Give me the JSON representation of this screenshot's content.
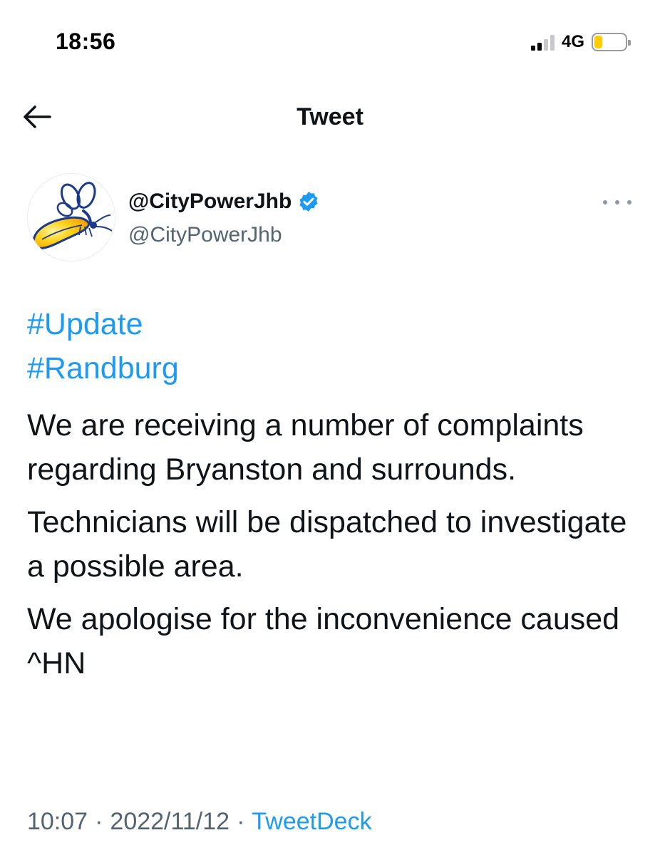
{
  "status_bar": {
    "time": "18:56",
    "network": "4G",
    "signal_bars_active": 2,
    "signal_bars_total": 4,
    "battery_level": 0.25,
    "battery_color": "#ffcc00"
  },
  "nav": {
    "back_icon": "arrow-left-icon",
    "title": "Tweet"
  },
  "author": {
    "avatar_icon": "city-power-firefly-logo",
    "display_name": "@CityPowerJhb",
    "verified_icon": "verified-badge-icon",
    "handle": "@CityPowerJhb",
    "more_icon": "more-horizontal-icon"
  },
  "tweet": {
    "hashtags": [
      "#Update",
      "#Randburg"
    ],
    "paragraphs": [
      "We are receiving a number of complaints regarding Bryanston and surrounds.",
      "Technicians will be dispatched to investigate a possible area.",
      "We apologise for the inconvenience caused ^HN"
    ]
  },
  "meta": {
    "time": "10:07",
    "separator": "·",
    "date": "2022/11/12",
    "source": "TweetDeck"
  },
  "colors": {
    "link": "#1d9bf0",
    "text": "#0f1419",
    "secondary": "#536471"
  }
}
